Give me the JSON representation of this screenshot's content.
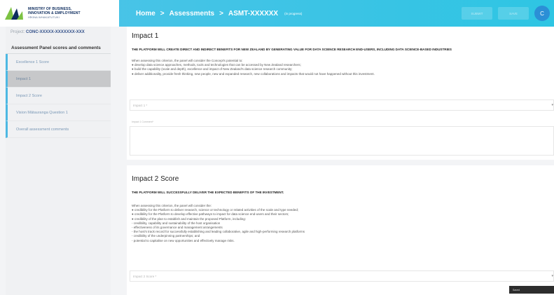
{
  "brand": {
    "logo_text": [
      "MINISTRY OF BUSINESS,",
      "INNOVATION & EMPLOYMENT",
      "HĪKINA WHAKATUTUKI"
    ]
  },
  "breadcrumb": {
    "home": "Home",
    "sep": ">",
    "assessments": "Assessments",
    "current": "ASMT-XXXXXX",
    "status": "(in progress)"
  },
  "topbar": {
    "btn1": "SUBMIT",
    "btn2": "SAVE",
    "user_initial": "C"
  },
  "sidebar": {
    "project_label": "Project:",
    "project_id": "CONC-XXXXX-XXXXXXX-XXX",
    "title": "Assessment Panel scores and comments",
    "items": [
      {
        "label": "Excellence 1 Score"
      },
      {
        "label": "Impact 1"
      },
      {
        "label": "Impact 2 Score"
      },
      {
        "label": "Vision Mātauranga Question 1"
      },
      {
        "label": "Overall assessment comments"
      }
    ]
  },
  "impact1": {
    "title": "Impact 1",
    "subtitle": "THE PLATFORM WILL CREATE DIRECT AND INDIRECT BENEFITS FOR NEW ZEALAND BY GENERATING VALUE FOR DATA SCIENCE RESEARCH END-USERS, INCLUDING DATA SCIENCE-BASED INDUSTRIES",
    "lines": [
      "When assessing this criterion, the panel will consider the Concept's potential to:",
      "● develop data science approaches, methods, tools and technologies that can be accessed by New Zealand researchers;",
      "● build the capability (scale and depth), excellence and impact of New Zealand's data science research community;",
      "● deliver additionality, provide fresh thinking, new people, new and expanded research, new collaborations and impacts that would not have happened without this investment."
    ],
    "select_placeholder": "Impact 1 *",
    "comment_label": "Impact 1 Comment*"
  },
  "impact2": {
    "title": "Impact 2 Score",
    "subtitle": "THE PLATFORM WILL SUCCESSFULLY DELIVER THE EXPECTED BENEFITS OF THE INVESTMENT.",
    "lines": [
      "When assessing this criterion, the panel will consider the:",
      "● credibility for the Platform to deliver research, science or technology or related activities of the scale and type needed;",
      "● credibility for the Platform to develop effective pathways to impact for data science end-users and their sectors;",
      "● credibility of the plan to establish and maintain the proposed Platform, including:",
      "- credibility, capability and sustainability of the host organisation",
      "- effectiveness of its governance and management arrangements",
      "- the host's track record for successfully establishing and leading collaborative, agile and high-performing research platforms",
      "- credibility of the underpinning partnerships; and",
      "- potential to capitalise on new opportunities and effectively manage risks."
    ],
    "select_placeholder": "Impact 2 Score *"
  },
  "toast": {
    "text": "Saved"
  },
  "colors": {
    "topbar": "#2ec5e3",
    "accent": "#4db8e3",
    "active_item": "#c7c8ca"
  }
}
